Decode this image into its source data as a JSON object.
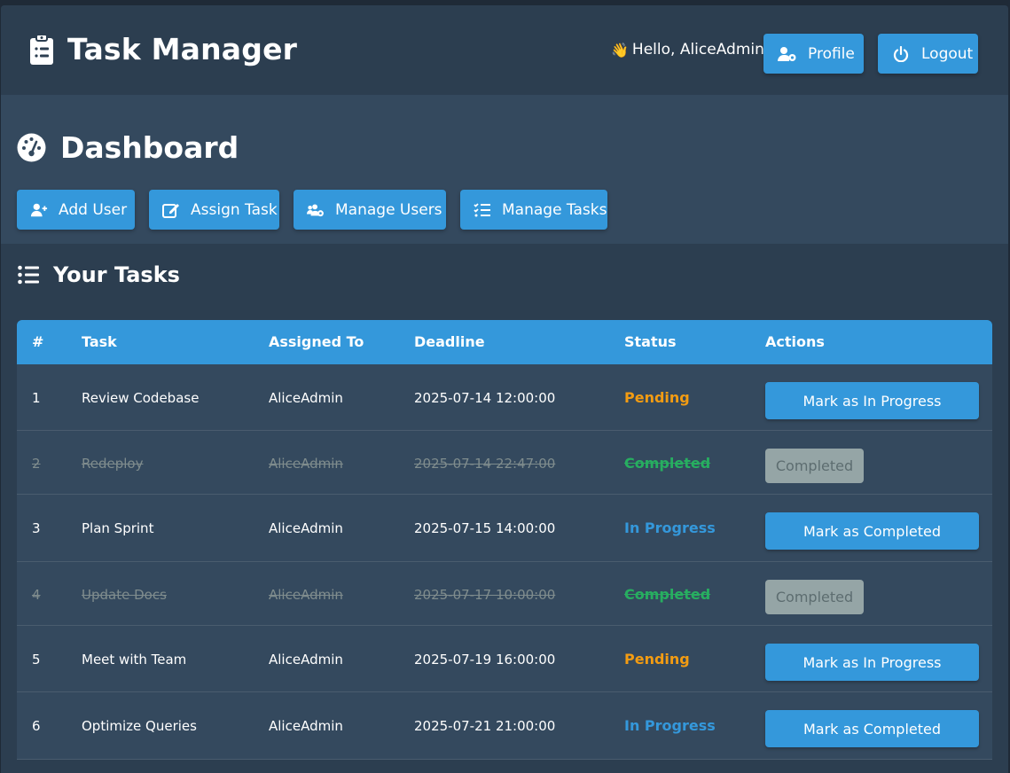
{
  "header": {
    "title": "Task Manager",
    "greeting_icon": "👋",
    "greeting": "Hello, AliceAdmin",
    "profile_label": "Profile",
    "logout_label": "Logout"
  },
  "dashboard": {
    "title": "Dashboard",
    "actions": [
      {
        "label": "Add User",
        "icon": "user-plus-icon"
      },
      {
        "label": "Assign Task",
        "icon": "edit-icon"
      },
      {
        "label": "Manage Users",
        "icon": "users-cog-icon"
      },
      {
        "label": "Manage Tasks",
        "icon": "tasks-icon"
      }
    ]
  },
  "tasks": {
    "title": "Your Tasks",
    "columns": [
      "#",
      "Task",
      "Assigned To",
      "Deadline",
      "Status",
      "Actions"
    ],
    "rows": [
      {
        "num": "1",
        "task": "Review Codebase",
        "assigned": "AliceAdmin",
        "deadline": "2025-07-14 12:00:00",
        "status": "Pending",
        "action": "Mark as In Progress"
      },
      {
        "num": "2",
        "task": "Redeploy",
        "assigned": "AliceAdmin",
        "deadline": "2025-07-14 22:47:00",
        "status": "Completed",
        "action": "Completed"
      },
      {
        "num": "3",
        "task": "Plan Sprint",
        "assigned": "AliceAdmin",
        "deadline": "2025-07-15 14:00:00",
        "status": "In Progress",
        "action": "Mark as Completed"
      },
      {
        "num": "4",
        "task": "Update Docs",
        "assigned": "AliceAdmin",
        "deadline": "2025-07-17 10:00:00",
        "status": "Completed",
        "action": "Completed"
      },
      {
        "num": "5",
        "task": "Meet with Team",
        "assigned": "AliceAdmin",
        "deadline": "2025-07-19 16:00:00",
        "status": "Pending",
        "action": "Mark as In Progress"
      },
      {
        "num": "6",
        "task": "Optimize Queries",
        "assigned": "AliceAdmin",
        "deadline": "2025-07-21 21:00:00",
        "status": "In Progress",
        "action": "Mark as Completed"
      }
    ]
  },
  "colors": {
    "accent": "#3498db",
    "pending": "#f39c12",
    "in_progress": "#3498db",
    "completed": "#27ae60",
    "disabled": "#95a5a6"
  }
}
